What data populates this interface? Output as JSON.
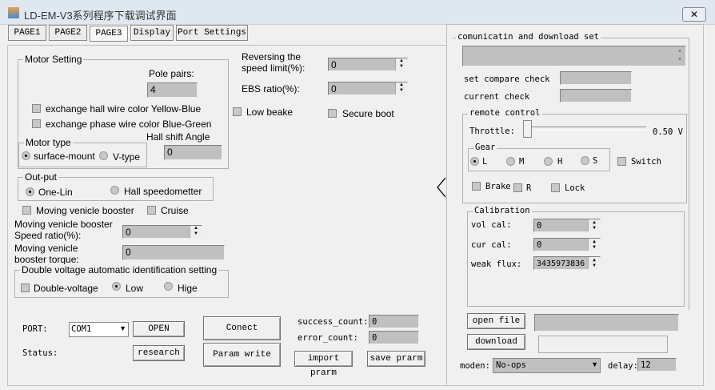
{
  "window": {
    "title": "LD-EM-V3系列程序下载调试界面",
    "close": "✕"
  },
  "tabs": [
    "PAGE1",
    "PAGE2",
    "PAGE3",
    "Display",
    "Port Settings"
  ],
  "motor": {
    "group": "Motor Setting",
    "pole_label": "Pole pairs:",
    "pole_value": "4",
    "hall_swap": "exchange hall wire color Yellow-Blue",
    "phase_swap": "exchange phase wire color Blue-Green",
    "hall_angle_label": "Hall shift Angle",
    "hall_angle_value": "0",
    "type_group": "Motor type",
    "type_opts": [
      "surface-mount",
      "V-type"
    ]
  },
  "rev_label": "Reversing the speed limit(%):",
  "rev_value": "0",
  "ebs_label": "EBS ratio(%):",
  "ebs_value": "0",
  "low_brake": "Low beake",
  "secure_boot": "Secure boot",
  "output": {
    "group": "Out-put",
    "opts": [
      "One-Lin",
      "Hall speedometter"
    ]
  },
  "booster": "Moving venicle booster",
  "cruise": "Cruise",
  "booster_speed_label": "Moving venicle booster Speed ratio(%):",
  "booster_speed_value": "0",
  "booster_torque_label": "Moving venicle booster torque:",
  "booster_torque_value": "0",
  "dv": {
    "group": "Double voltage automatic identification setting",
    "double": "Double-voltage",
    "low": "Low",
    "high": "Hige"
  },
  "port": {
    "label": "PORT:",
    "value": "COM1",
    "open": "OPEN",
    "status": "Status:",
    "research": "research",
    "connect": "Conect",
    "param_write": "Param write",
    "success_label": "success_count:",
    "success_value": "0",
    "error_label": "error_count:",
    "error_value": "0",
    "import": "import prarm",
    "save": "save prarm"
  },
  "comm": {
    "group": "comunicatin and download set",
    "compare": "set compare check value",
    "current": "current check value"
  },
  "remote": {
    "group": "remote control",
    "throttle": "Throttle:",
    "throttle_value": "0.50 V",
    "throttle_fraction": 0.0,
    "gear": "Gear",
    "gears": [
      "L",
      "M",
      "H",
      "S"
    ],
    "switch": "Switch",
    "brake": "Brake",
    "r": "R",
    "lock": "Lock"
  },
  "cal": {
    "group": "Calibration",
    "vol": "vol cal:",
    "vol_value": "0",
    "cur": "cur cal:",
    "cur_value": "0",
    "flux": "weak flux:",
    "flux_value": "3435973836"
  },
  "file": {
    "open": "open file",
    "download": "download",
    "moden_label": "moden:",
    "moden_value": "No-ops",
    "delay_label": "delay:",
    "delay_value": "12"
  }
}
